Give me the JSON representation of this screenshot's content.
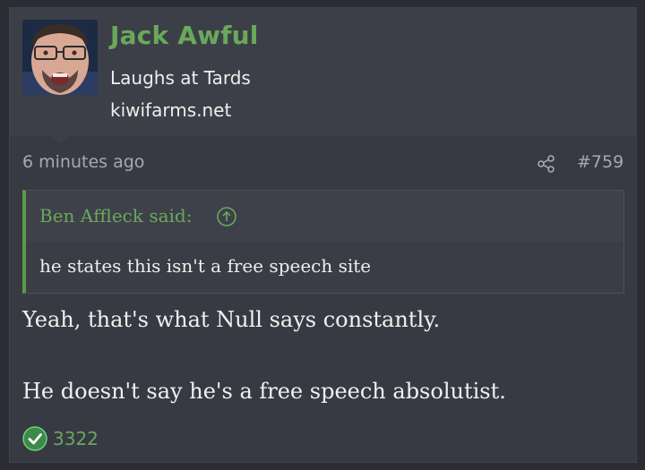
{
  "user": {
    "name": "Jack Awful",
    "title": "Laughs at Tards",
    "site": "kiwifarms.net",
    "avatar_icon": "user-avatar"
  },
  "meta": {
    "time": "6 minutes ago",
    "post_number": "#759",
    "share_icon": "share-icon"
  },
  "quote": {
    "attribution": "Ben Affleck said:",
    "up_icon": "arrow-up-circle-icon",
    "body": "he states this isn't a free speech site"
  },
  "message": {
    "lines": [
      "Yeah, that's what Null says constantly.",
      "He doesn't say he's a free speech absolutist."
    ]
  },
  "reaction": {
    "icon": "checkmark-circle-icon",
    "count": "3322"
  },
  "colors": {
    "background": "#2a2d33",
    "post_bg": "#373a42",
    "accent_green": "#6aa85b",
    "muted_text": "#a6a9ae"
  }
}
